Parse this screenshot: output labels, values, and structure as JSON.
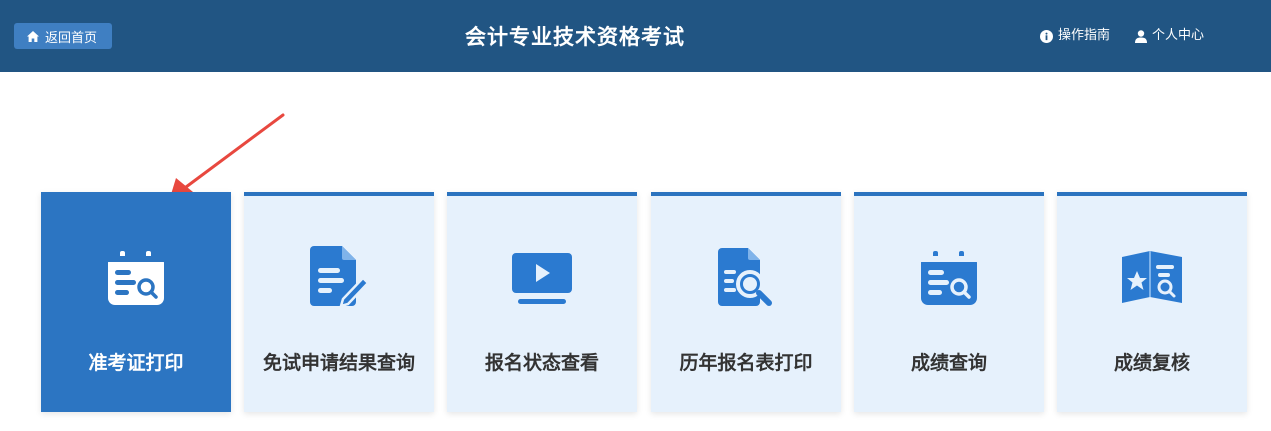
{
  "header": {
    "home_button": "返回首页",
    "title": "会计专业技术资格考试",
    "guide_link": "操作指南",
    "user_center_link": "个人中心"
  },
  "cards": [
    {
      "label": "准考证打印",
      "icon": "calendar-search-icon",
      "active": true
    },
    {
      "label": "免试申请结果查询",
      "icon": "document-edit-icon",
      "active": false
    },
    {
      "label": "报名状态查看",
      "icon": "video-play-icon",
      "active": false
    },
    {
      "label": "历年报名表打印",
      "icon": "document-search-icon",
      "active": false
    },
    {
      "label": "成绩查询",
      "icon": "calendar-search-icon",
      "active": false
    },
    {
      "label": "成绩复核",
      "icon": "book-star-search-icon",
      "active": false
    }
  ],
  "colors": {
    "header_bg": "#215583",
    "home_button_bg": "#3f7fc2",
    "card_bg": "#e6f1fc",
    "card_active_bg": "#2c75c2",
    "card_top_border": "#2b73bf",
    "icon_blue": "#2b7ad0",
    "arrow_red": "#e8483f"
  }
}
